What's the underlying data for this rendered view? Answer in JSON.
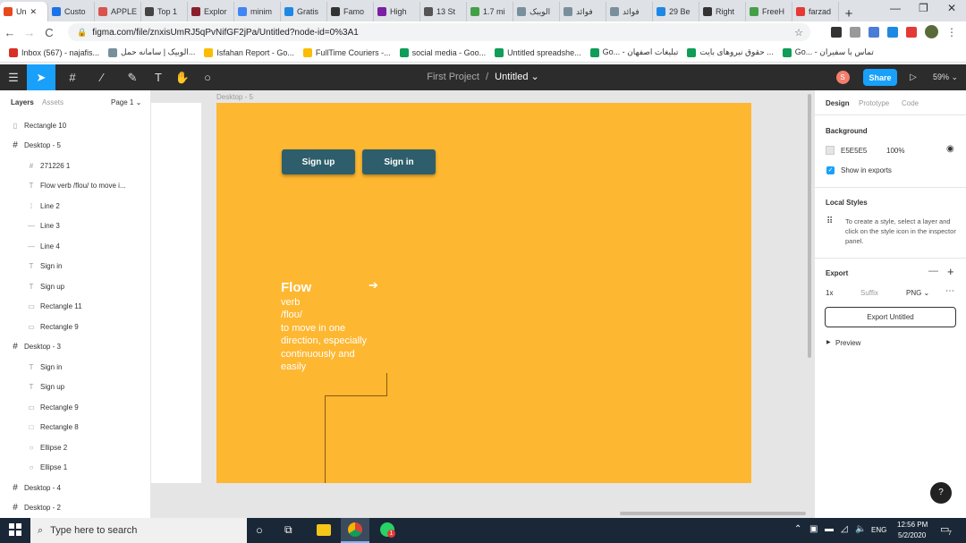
{
  "browser": {
    "tabs": [
      {
        "label": "Un",
        "color": "#e8491d",
        "active": true
      },
      {
        "label": "Custo",
        "color": "#1a73e8"
      },
      {
        "label": "APPLE",
        "color": "#d9534f"
      },
      {
        "label": "Top 1",
        "color": "#444"
      },
      {
        "label": "Explor",
        "color": "#8b1e2c"
      },
      {
        "label": "minim",
        "color": "#4285f4"
      },
      {
        "label": "Gratis",
        "color": "#1e88e5"
      },
      {
        "label": "Famo",
        "color": "#333"
      },
      {
        "label": "High",
        "color": "#7b1fa2"
      },
      {
        "label": "13 St",
        "color": "#555"
      },
      {
        "label": "1.7 mi",
        "color": "#43a047"
      },
      {
        "label": "الويبک",
        "color": "#78909c"
      },
      {
        "label": "فوائد",
        "color": "#78909c"
      },
      {
        "label": "فوائد",
        "color": "#78909c"
      },
      {
        "label": "29 Be",
        "color": "#1e88e5"
      },
      {
        "label": "Right",
        "color": "#333"
      },
      {
        "label": "FreeH",
        "color": "#43a047"
      },
      {
        "label": "farzad",
        "color": "#e53935"
      }
    ],
    "close_tab_glyph": "✕",
    "new_tab_glyph": "+",
    "url": "figma.com/file/znxisUmRJ5qPvNifGF2jPa/Untitled?node-id=0%3A1",
    "window_controls": [
      "—",
      "❐",
      "✕"
    ],
    "nav_back": "←",
    "nav_forward": "→",
    "nav_reload": "C",
    "bookmarks": [
      {
        "label": "Inbox (567) - najafis...",
        "color": "#d93025"
      },
      {
        "label": "الوبیک | سامانه حمل...",
        "color": "#78909c"
      },
      {
        "label": "Isfahan Report - Go...",
        "color": "#fbbc04"
      },
      {
        "label": "FullTime Couriers -...",
        "color": "#fbbc04"
      },
      {
        "label": "social media - Goo...",
        "color": "#0f9d58"
      },
      {
        "label": "Untitled spreadshe...",
        "color": "#0f9d58"
      },
      {
        "label": "Go... - تبلیغات اصفهان",
        "color": "#0f9d58"
      },
      {
        "label": "حقوق نیروهای بایت ...",
        "color": "#0f9d58"
      },
      {
        "label": "Go... - تماس با سفیران",
        "color": "#0f9d58"
      }
    ]
  },
  "figma": {
    "project": "First Project",
    "separator": "/",
    "file": "Untitled ⌄",
    "share_label": "Share",
    "zoom": "59% ⌄",
    "avatar_letter": "S",
    "layers_tab": "Layers",
    "assets_tab": "Assets",
    "page_selector": "Page 1 ⌄",
    "layers": [
      {
        "icon": "▯",
        "label": "Rectangle 10",
        "indent": 0
      },
      {
        "icon": "#",
        "label": "Desktop - 5",
        "indent": 0,
        "frame": true
      },
      {
        "icon": "#",
        "label": "271226 1",
        "indent": 1
      },
      {
        "icon": "T",
        "label": "Flow verb /flou/ to move i...",
        "indent": 1
      },
      {
        "icon": "⁞",
        "label": "Line 2",
        "indent": 1
      },
      {
        "icon": "—",
        "label": "Line 3",
        "indent": 1
      },
      {
        "icon": "—",
        "label": "Line 4",
        "indent": 1
      },
      {
        "icon": "T",
        "label": "Sign in",
        "indent": 1
      },
      {
        "icon": "T",
        "label": "Sign up",
        "indent": 1
      },
      {
        "icon": "▭",
        "label": "Rectangle 11",
        "indent": 1
      },
      {
        "icon": "▭",
        "label": "Rectangle 9",
        "indent": 1
      },
      {
        "icon": "#",
        "label": "Desktop - 3",
        "indent": 0,
        "frame": true
      },
      {
        "icon": "T",
        "label": "Sign in",
        "indent": 1
      },
      {
        "icon": "T",
        "label": "Sign up",
        "indent": 1
      },
      {
        "icon": "▭",
        "label": "Rectangle 9",
        "indent": 1
      },
      {
        "icon": "□",
        "label": "Rectangle 8",
        "indent": 1
      },
      {
        "icon": "○",
        "label": "Ellipse 2",
        "indent": 1
      },
      {
        "icon": "○",
        "label": "Ellipse 1",
        "indent": 1
      },
      {
        "icon": "#",
        "label": "Desktop - 4",
        "indent": 0,
        "frame": true
      },
      {
        "icon": "#",
        "label": "Desktop - 2",
        "indent": 0,
        "frame": true
      }
    ],
    "frame_label": "Desktop - 5",
    "frame_color": "#fdb731",
    "signup_label": "Sign up",
    "signin_label": "Sign in",
    "flow": {
      "title": "Flow",
      "arrow": "➔",
      "lines": [
        "verb",
        "/floʊ/",
        "to move in one",
        "direction, especially",
        "continuously and",
        "easily"
      ]
    },
    "inspector": {
      "tabs": [
        "Design",
        "Prototype",
        "Code"
      ],
      "background_title": "Background",
      "bg_hex": "E5E5E5",
      "bg_opacity": "100%",
      "show_in_exports": "Show in exports",
      "local_styles_title": "Local Styles",
      "local_styles_hint": "To create a style, select a layer and click on the style icon in the inspector panel.",
      "export_title": "Export",
      "export_scale": "1x",
      "export_suffix": "Suffix",
      "export_format": "PNG ⌄",
      "export_button": "Export Untitled",
      "preview_label": "Preview",
      "help_glyph": "?"
    }
  },
  "taskbar": {
    "search_placeholder": "Type here to search",
    "lang": "ENG",
    "time": "12:56 PM",
    "date": "5/2/2020",
    "notif_count": "7"
  }
}
